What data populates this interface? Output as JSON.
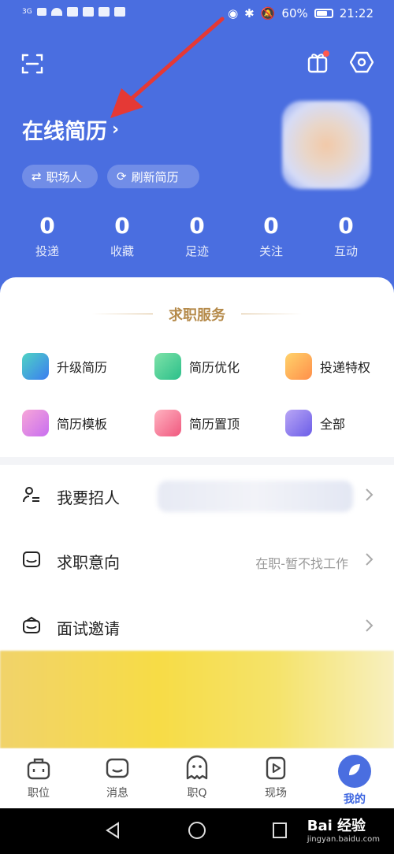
{
  "status_bar": {
    "left_text": "3G",
    "battery": "60%",
    "time": "21:22"
  },
  "header": {
    "resume_title": "在线简历",
    "chips": {
      "role": "职场人",
      "refresh": "刷新简历"
    }
  },
  "stats": [
    {
      "value": "0",
      "label": "投递"
    },
    {
      "value": "0",
      "label": "收藏"
    },
    {
      "value": "0",
      "label": "足迹"
    },
    {
      "value": "0",
      "label": "关注"
    },
    {
      "value": "0",
      "label": "互动"
    }
  ],
  "services": {
    "title": "求职服务",
    "items": [
      {
        "label": "升级简历"
      },
      {
        "label": "简历优化"
      },
      {
        "label": "投递特权"
      },
      {
        "label": "简历模板"
      },
      {
        "label": "简历置顶"
      },
      {
        "label": "全部"
      }
    ]
  },
  "menu": [
    {
      "label": "我要招人",
      "value": ""
    },
    {
      "label": "求职意向",
      "value": "在职-暂不找工作"
    },
    {
      "label": "面试邀请",
      "value": ""
    }
  ],
  "tabbar": [
    {
      "label": "职位"
    },
    {
      "label": "消息"
    },
    {
      "label": "职Q"
    },
    {
      "label": "现场"
    },
    {
      "label": "我的"
    }
  ],
  "watermark": {
    "brand": "Bai 经验",
    "url": "jingyan.baidu.com"
  },
  "colors": {
    "primary": "#4a6ee0",
    "accent_gold": "#b58a4a",
    "annotation_red": "#e53935"
  }
}
